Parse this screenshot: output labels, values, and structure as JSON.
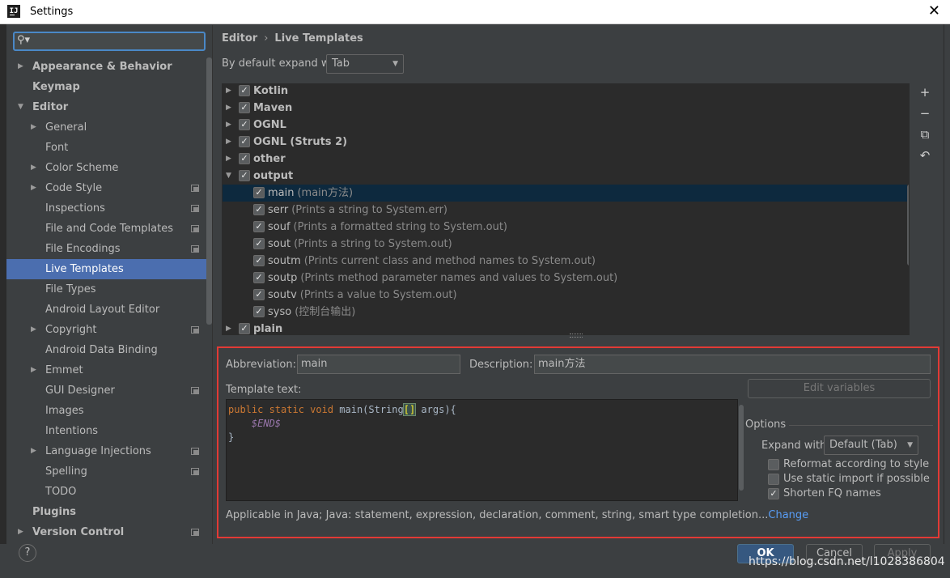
{
  "window": {
    "title": "Settings",
    "app_icon": "IJ"
  },
  "search": {
    "placeholder": "",
    "icon": "search-icon"
  },
  "sidebar": {
    "items": [
      {
        "label": "Appearance & Behavior",
        "level": 0,
        "expandable": true,
        "expanded": false,
        "bold": true
      },
      {
        "label": "Keymap",
        "level": 0,
        "bold": true
      },
      {
        "label": "Editor",
        "level": 0,
        "expandable": true,
        "expanded": true,
        "bold": true
      },
      {
        "label": "General",
        "level": 1,
        "expandable": true
      },
      {
        "label": "Font",
        "level": 1
      },
      {
        "label": "Color Scheme",
        "level": 1,
        "expandable": true
      },
      {
        "label": "Code Style",
        "level": 1,
        "expandable": true,
        "project_icon": true
      },
      {
        "label": "Inspections",
        "level": 1,
        "project_icon": true
      },
      {
        "label": "File and Code Templates",
        "level": 1,
        "project_icon": true
      },
      {
        "label": "File Encodings",
        "level": 1,
        "project_icon": true
      },
      {
        "label": "Live Templates",
        "level": 1,
        "selected": true
      },
      {
        "label": "File Types",
        "level": 1
      },
      {
        "label": "Android Layout Editor",
        "level": 1
      },
      {
        "label": "Copyright",
        "level": 1,
        "expandable": true,
        "project_icon": true
      },
      {
        "label": "Android Data Binding",
        "level": 1
      },
      {
        "label": "Emmet",
        "level": 1,
        "expandable": true
      },
      {
        "label": "GUI Designer",
        "level": 1,
        "project_icon": true
      },
      {
        "label": "Images",
        "level": 1
      },
      {
        "label": "Intentions",
        "level": 1
      },
      {
        "label": "Language Injections",
        "level": 1,
        "expandable": true,
        "project_icon": true
      },
      {
        "label": "Spelling",
        "level": 1,
        "project_icon": true
      },
      {
        "label": "TODO",
        "level": 1
      },
      {
        "label": "Plugins",
        "level": 0,
        "bold": true
      },
      {
        "label": "Version Control",
        "level": 0,
        "expandable": true,
        "bold": true,
        "project_icon": true
      }
    ]
  },
  "breadcrumb": {
    "parent": "Editor",
    "separator": "›",
    "current": "Live Templates"
  },
  "expand_default": {
    "label": "By default expand with",
    "value": "Tab"
  },
  "templates": [
    {
      "type": "group",
      "name": "Kotlin",
      "checked": true,
      "expanded": false
    },
    {
      "type": "group",
      "name": "Maven",
      "checked": true,
      "expanded": false
    },
    {
      "type": "group",
      "name": "OGNL",
      "checked": true,
      "expanded": false
    },
    {
      "type": "group",
      "name": "OGNL (Struts 2)",
      "checked": true,
      "expanded": false
    },
    {
      "type": "group",
      "name": "other",
      "checked": true,
      "expanded": false
    },
    {
      "type": "group",
      "name": "output",
      "checked": true,
      "expanded": true
    },
    {
      "type": "item",
      "abbr": "main",
      "desc": "(main方法)",
      "checked": true,
      "selected": true
    },
    {
      "type": "item",
      "abbr": "serr",
      "desc": "(Prints a string to System.err)",
      "checked": true
    },
    {
      "type": "item",
      "abbr": "souf",
      "desc": "(Prints a formatted string to System.out)",
      "checked": true
    },
    {
      "type": "item",
      "abbr": "sout",
      "desc": "(Prints a string to System.out)",
      "checked": true
    },
    {
      "type": "item",
      "abbr": "soutm",
      "desc": "(Prints current class and method names to System.out)",
      "checked": true
    },
    {
      "type": "item",
      "abbr": "soutp",
      "desc": "(Prints method parameter names and values to System.out)",
      "checked": true
    },
    {
      "type": "item",
      "abbr": "soutv",
      "desc": "(Prints a value to System.out)",
      "checked": true
    },
    {
      "type": "item",
      "abbr": "syso",
      "desc": "(控制台输出)",
      "checked": true
    },
    {
      "type": "group",
      "name": "plain",
      "checked": true,
      "expanded": false
    }
  ],
  "toolbar": {
    "add": "+",
    "remove": "−",
    "copy": "⧉",
    "restore": "↶"
  },
  "editor": {
    "abbreviation_label": "Abbreviation:",
    "abbreviation_value": "main",
    "description_label": "Description:",
    "description_value": "main方法",
    "template_text_label": "Template text:",
    "code": {
      "kw": "public static void",
      "name": " main(String",
      "brackets": "[]",
      "rest": " args){",
      "var": "$END$",
      "close": "}"
    },
    "edit_variables": "Edit variables",
    "options_title": "Options",
    "expand_with_label": "Expand with",
    "expand_with_value": "Default (Tab)",
    "options": [
      {
        "label": "Reformat according to style",
        "checked": false
      },
      {
        "label": "Use static import if possible",
        "checked": false
      },
      {
        "label": "Shorten FQ names",
        "checked": true
      }
    ],
    "applicable_text": "Applicable in Java; Java: statement, expression, declaration, comment, string, smart type completion...",
    "change_link": "Change"
  },
  "footer": {
    "help": "?",
    "ok": "OK",
    "cancel": "Cancel",
    "apply": "Apply",
    "watermark": "https://blog.csdn.net/l1028386804"
  },
  "colors": {
    "accent": "#4b6eaf",
    "highlight_border": "#e23a35",
    "link": "#589df6"
  }
}
